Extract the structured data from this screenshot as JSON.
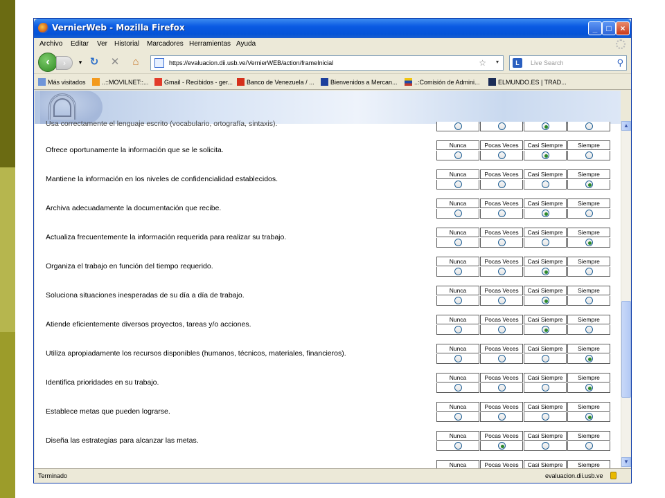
{
  "window": {
    "title": "VernierWeb - Mozilla Firefox"
  },
  "menu": [
    "Archivo",
    "Editar",
    "Ver",
    "Historial",
    "Marcadores",
    "Herramientas",
    "Ayuda"
  ],
  "nav": {
    "url": "https://evaluacion.dii.usb.ve/VernierWEB/action/frameInicial",
    "search_placeholder": "Live Search"
  },
  "bookmarks": [
    "Más visitados",
    "..::MOVILNET::...",
    "Gmail - Recibidos - ger...",
    "Banco de Venezuela / ...",
    "Bienvenidos a Mercan...",
    "..:Comisión de Admini...",
    "ELMUNDO.ES | TRAD..."
  ],
  "options": [
    "Nunca",
    "Pocas Veces",
    "Casi Siempre",
    "Siempre"
  ],
  "partial_question": "Usa correctamente el lenguaje escrito (vocabulario, ortografía, sintaxis).",
  "questions": [
    {
      "text": "Ofrece oportunamente la información que se le solicita.",
      "selected": 2
    },
    {
      "text": "Mantiene la información en los niveles de confidencialidad establecidos.",
      "selected": 3
    },
    {
      "text": "Archiva adecuadamente la documentación que recibe.",
      "selected": 2
    },
    {
      "text": "Actualiza frecuentemente la información requerida para realizar su trabajo.",
      "selected": 3
    },
    {
      "text": "Organiza el trabajo en función del tiempo requerido.",
      "selected": 2
    },
    {
      "text": "Soluciona situaciones inesperadas de su día a día de trabajo.",
      "selected": 2
    },
    {
      "text": "Atiende eficientemente diversos proyectos, tareas y/o acciones.",
      "selected": 2
    },
    {
      "text": "Utiliza apropiadamente los recursos disponibles (humanos, técnicos, materiales, financieros).",
      "selected": 3
    },
    {
      "text": "Identifica prioridades en su trabajo.",
      "selected": 3
    },
    {
      "text": "Establece metas que pueden lograrse.",
      "selected": 3
    },
    {
      "text": "Diseña las estrategias para alcanzar las metas.",
      "selected": 1
    }
  ],
  "status": {
    "left": "Terminado",
    "right": "evaluacion.dii.usb.ve"
  }
}
